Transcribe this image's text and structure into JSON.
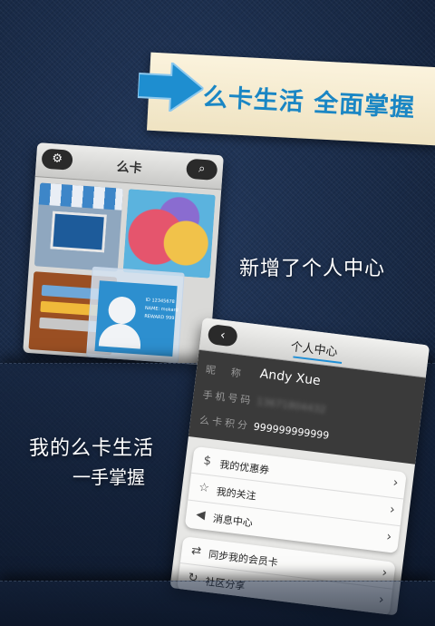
{
  "banner": {
    "text": "么卡生活 全面掌握"
  },
  "callouts": {
    "new_feature": "新增了个人中心",
    "life_line1": "我的么卡生活",
    "life_line2": "一手掌握"
  },
  "home_screen": {
    "title": "么卡",
    "settings_icon": "gear-icon",
    "search_icon": "search-icon",
    "id_card": {
      "id_line": "ID 12345678",
      "name_line": "NAME: mokard",
      "reward_line": "REWARD 999"
    }
  },
  "profile_screen": {
    "back_label": "‹",
    "title": "个人中心",
    "nickname_label": "昵　称",
    "nickname_value": "Andy Xue",
    "phone_label": "手机号码",
    "phone_value": "13671804432",
    "points_label": "么卡积分",
    "points_value": "999999999999",
    "menu": [
      {
        "icon": "coupon-icon",
        "label": "我的优惠券"
      },
      {
        "icon": "star-icon",
        "label": "我的关注"
      },
      {
        "icon": "megaphone-icon",
        "label": "消息中心"
      }
    ],
    "menu2": [
      {
        "icon": "shuffle-icon",
        "label": "同步我的会员卡"
      },
      {
        "icon": "share-icon",
        "label": "社区分享"
      }
    ]
  }
}
